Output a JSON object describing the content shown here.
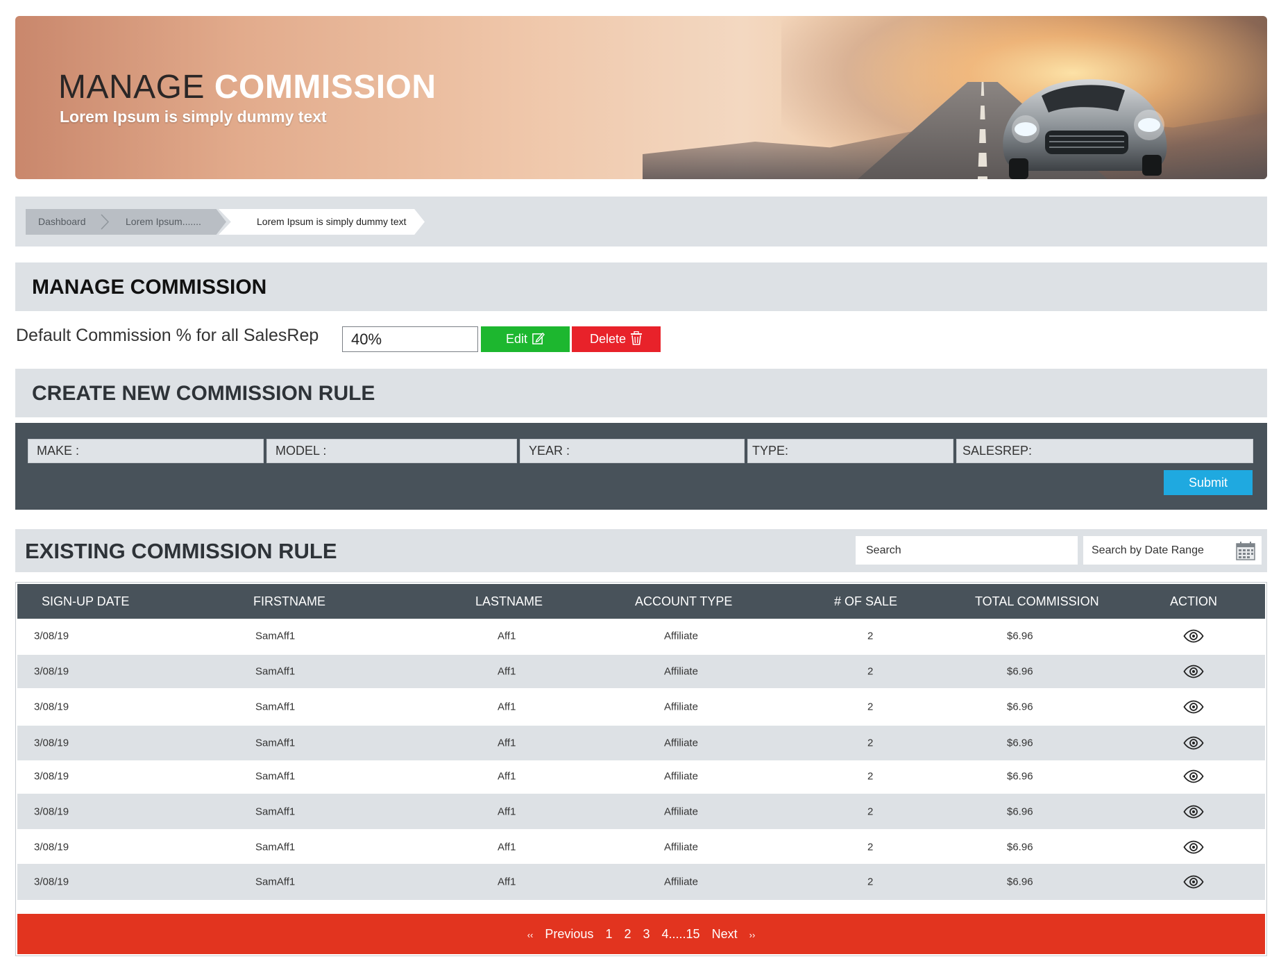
{
  "hero": {
    "title_light": "MANAGE",
    "title_bold": "COMMISSION",
    "subtitle": "Lorem Ipsum is simply dummy text"
  },
  "breadcrumb": {
    "items": [
      "Dashboard",
      "Lorem Ipsum.......",
      "Lorem Ipsum is simply dummy text"
    ]
  },
  "manage": {
    "heading": "MANAGE COMMISSION",
    "default_label": "Default Commission % for all SalesRep",
    "default_value": "40%",
    "edit_label": "Edit",
    "delete_label": "Delete"
  },
  "create": {
    "heading": "CREATE NEW COMMISSION RULE",
    "fields": {
      "make": "MAKE :",
      "model": "MODEL :",
      "year": "YEAR :",
      "type": "TYPE:",
      "salesrep": "SALESREP:"
    },
    "submit_label": "Submit"
  },
  "existing": {
    "heading": "EXISTING COMMISSION RULE",
    "search_placeholder": "Search",
    "date_range_placeholder": "Search by Date Range",
    "columns": [
      "SIGN-UP DATE",
      "FIRSTNAME",
      "LASTNAME",
      "ACCOUNT TYPE",
      "# OF SALE",
      "TOTAL COMMISSION",
      "ACTION"
    ],
    "rows": [
      {
        "date": "3/08/19",
        "first": "SamAff1",
        "last": "Aff1",
        "type": "Affiliate",
        "sales": "2",
        "commission": "$6.96"
      },
      {
        "date": "3/08/19",
        "first": "SamAff1",
        "last": "Aff1",
        "type": "Affiliate",
        "sales": "2",
        "commission": "$6.96"
      },
      {
        "date": "3/08/19",
        "first": "SamAff1",
        "last": "Aff1",
        "type": "Affiliate",
        "sales": "2",
        "commission": "$6.96"
      },
      {
        "date": "3/08/19",
        "first": "SamAff1",
        "last": "Aff1",
        "type": "Affiliate",
        "sales": "2",
        "commission": "$6.96"
      },
      {
        "date": "3/08/19",
        "first": "SamAff1",
        "last": "Aff1",
        "type": "Affiliate",
        "sales": "2",
        "commission": "$6.96"
      },
      {
        "date": "3/08/19",
        "first": "SamAff1",
        "last": "Aff1",
        "type": "Affiliate",
        "sales": "2",
        "commission": "$6.96"
      },
      {
        "date": "3/08/19",
        "first": "SamAff1",
        "last": "Aff1",
        "type": "Affiliate",
        "sales": "2",
        "commission": "$6.96"
      },
      {
        "date": "3/08/19",
        "first": "SamAff1",
        "last": "Aff1",
        "type": "Affiliate",
        "sales": "2",
        "commission": "$6.96"
      }
    ],
    "action_icon": "eye-icon"
  },
  "pager": {
    "prev_arrow": "‹‹",
    "previous": "Previous",
    "pages": [
      "1",
      "2",
      "3",
      "4.....15"
    ],
    "next": "Next",
    "next_arrow": "››"
  },
  "colors": {
    "dark_panel": "#48525a",
    "section_bg": "#dde1e5",
    "edit": "#1db72f",
    "delete": "#e8222a",
    "submit": "#1fa9e0",
    "pager": "#e2341f"
  }
}
